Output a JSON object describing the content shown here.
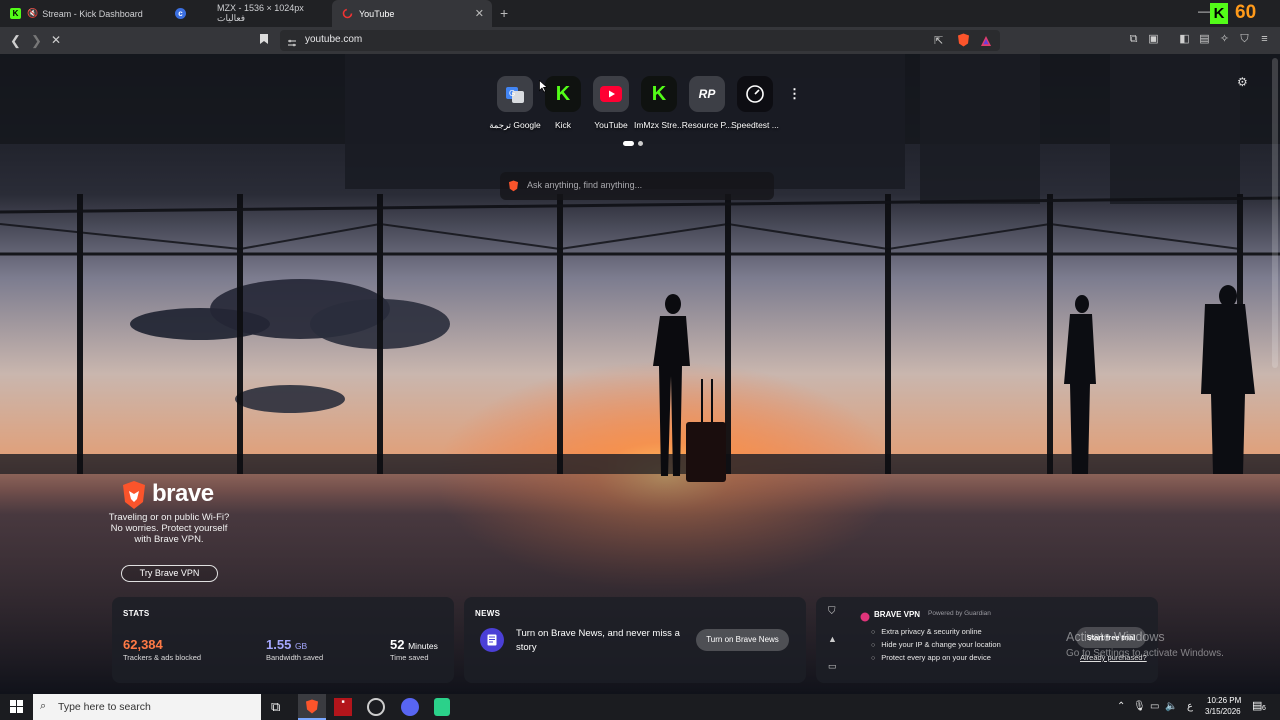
{
  "tabs": [
    {
      "title": "Stream - Kick Dashboard",
      "muted": true
    },
    {
      "title": ""
    },
    {
      "title": "MZX - 1536 × 1024px فعاليات"
    },
    {
      "title": "YouTube",
      "active": true
    }
  ],
  "overlay_counter": "60",
  "address": {
    "url": "youtube.com"
  },
  "top_sites": [
    {
      "label": "ترجمة Google",
      "icon": "google-translate-icon"
    },
    {
      "label": "Kick",
      "icon": "kick-icon"
    },
    {
      "label": "YouTube",
      "icon": "youtube-icon"
    },
    {
      "label": "ImMzx Stre...",
      "icon": "kick-icon"
    },
    {
      "label": "Resource P...",
      "icon": "rp-icon"
    },
    {
      "label": "Speedtest ...",
      "icon": "speedtest-icon"
    }
  ],
  "search": {
    "placeholder": "Ask anything, find anything..."
  },
  "promo": {
    "brand": "brave",
    "text": "Traveling or on public Wi-Fi? No worries. Protect yourself with Brave VPN.",
    "button": "Try Brave VPN"
  },
  "stats": {
    "title": "STATS",
    "trackers": {
      "value": "62,384",
      "label": "Trackers & ads blocked"
    },
    "bandwidth": {
      "value": "1.55",
      "unit": "GB",
      "label": "Bandwidth saved"
    },
    "time": {
      "value": "52",
      "unit": "Minutes",
      "label": "Time saved"
    }
  },
  "news": {
    "title": "NEWS",
    "text": "Turn on Brave News, and never miss a story",
    "button": "Turn on Brave News"
  },
  "vpn": {
    "title": "BRAVE VPN",
    "powered": "Powered by Guardian",
    "features": [
      "Extra privacy & security online",
      "Hide your IP & change your location",
      "Protect every app on your device"
    ],
    "trial_button": "Start free trial",
    "already": "Already purchased?"
  },
  "windows": {
    "activate_title": "Activate Windows",
    "activate_sub": "Go to Settings to activate Windows."
  },
  "taskbar": {
    "search_placeholder": "Type here to search",
    "time": "10:26 PM",
    "date": "3/15/2026",
    "lang": "ع",
    "notif_count": "6"
  },
  "colors": {
    "brave_orange": "#fb542b",
    "kick_green": "#53fc18",
    "stat_orange": "#ff7a45",
    "stat_blue": "#a6a8ff"
  }
}
